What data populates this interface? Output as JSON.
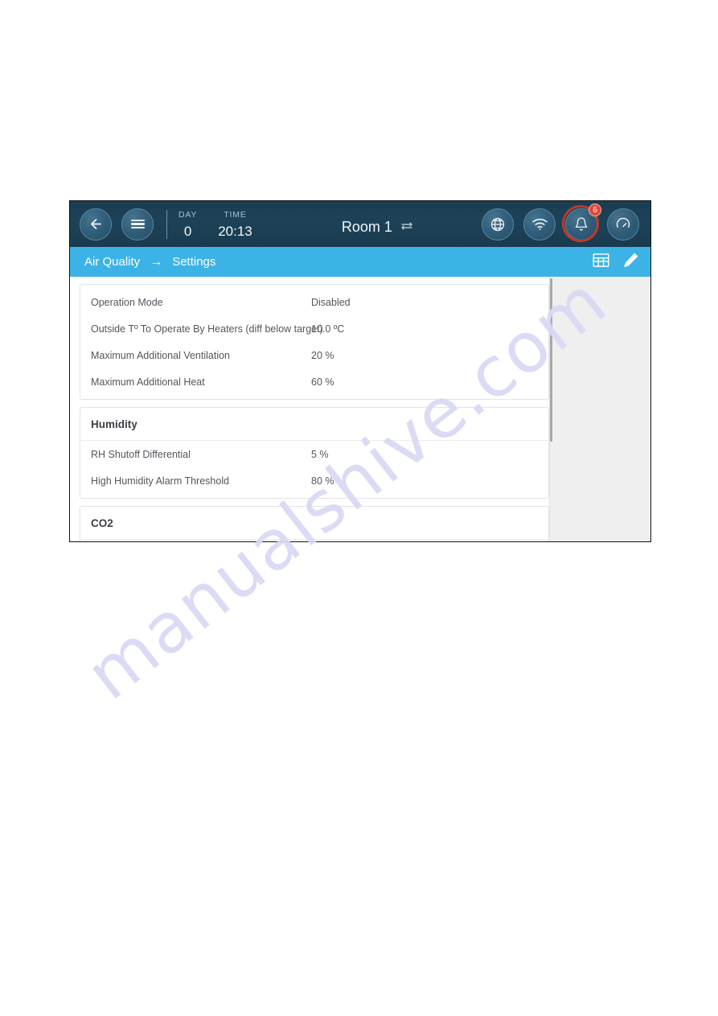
{
  "watermark": {
    "text": "manualshive.com"
  },
  "device": {
    "topbar": {
      "back_icon": "arrow-left-icon",
      "menu_icon": "hamburger-menu-icon",
      "day_label": "DAY",
      "day_value": "0",
      "time_label": "TIME",
      "time_value": "20:13",
      "room_name": "Room 1",
      "swap_icon": "swap-arrows-icon",
      "globe_icon": "globe-icon",
      "wifi_icon": "wifi-icon",
      "alarm_icon": "bell-icon",
      "alarm_count": "6",
      "gauge_icon": "gauge-icon"
    },
    "breadcrumb": {
      "parent": "Air Quality",
      "arrow": "→",
      "current": "Settings",
      "table_icon": "table-grid-icon",
      "edit_icon": "pencil-edit-icon"
    },
    "cards": [
      {
        "title": null,
        "rows": [
          {
            "label": "Operation Mode",
            "value": "Disabled"
          },
          {
            "label": "Outside Tº To Operate By Heaters (diff below target)",
            "value": "10.0 ºC"
          },
          {
            "label": "Maximum Additional Ventilation",
            "value": "20 %"
          },
          {
            "label": "Maximum Additional Heat",
            "value": "60 %"
          }
        ]
      },
      {
        "title": "Humidity",
        "rows": [
          {
            "label": "RH Shutoff Differential",
            "value": "5 %"
          },
          {
            "label": "High Humidity Alarm Threshold",
            "value": "80 %"
          }
        ]
      },
      {
        "title": "CO2",
        "rows": []
      }
    ]
  },
  "colors": {
    "topbar_bg": "#1d4257",
    "breadcrumb_bg": "#3cb3e6",
    "alarm_red": "#c0392b",
    "badge_red": "#e0483a",
    "watermark": "#d9d9f5"
  }
}
